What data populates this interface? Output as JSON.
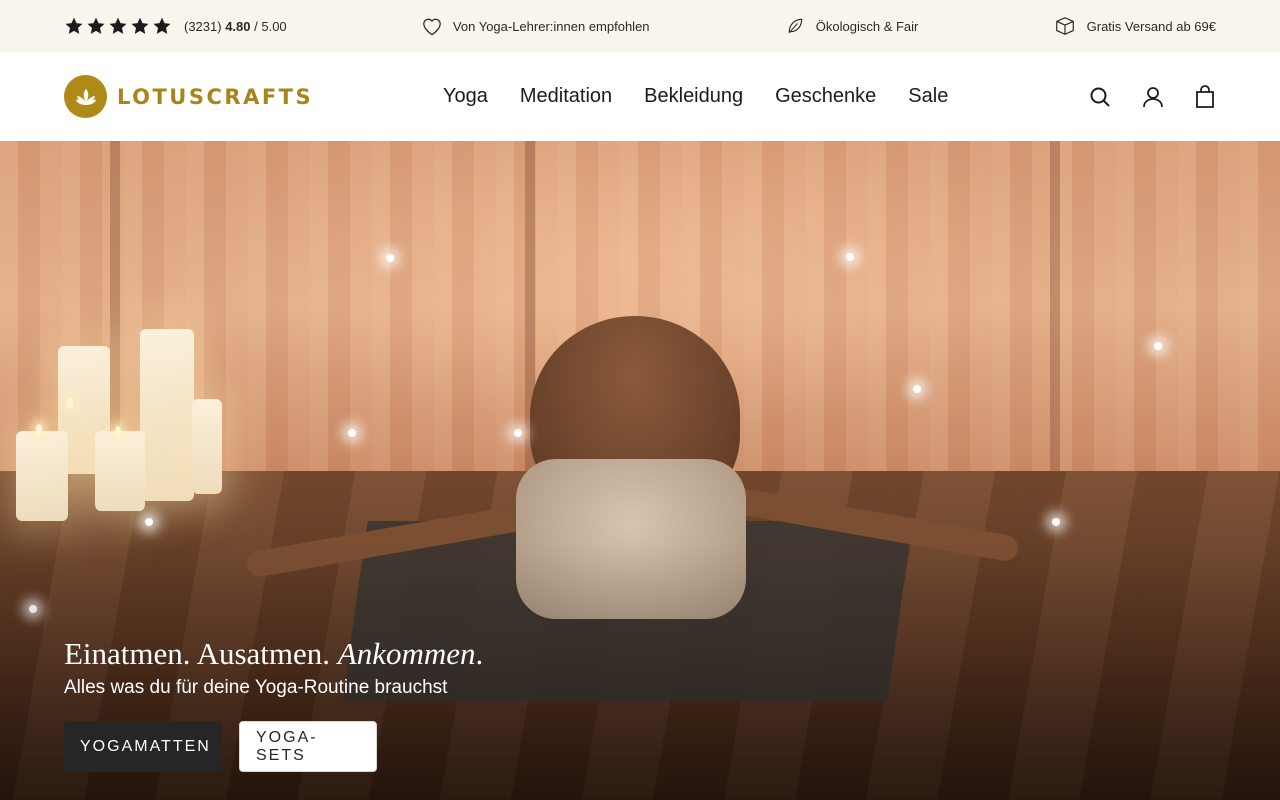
{
  "topbar": {
    "rating_count": "(3231)",
    "rating_value": "4.80",
    "rating_max": "/ 5.00",
    "stars": 5,
    "recommended": "Von Yoga-Lehrer:innen empfohlen",
    "eco": "Ökologisch & Fair",
    "shipping": "Gratis Versand ab 69€",
    "icons": [
      "star-icon",
      "heart-icon",
      "leaf-icon",
      "package-icon"
    ]
  },
  "header": {
    "logo_text": "LOTUSCRAFTS",
    "nav": [
      "Yoga",
      "Meditation",
      "Bekleidung",
      "Geschenke",
      "Sale"
    ],
    "icons": [
      "search-icon",
      "account-icon",
      "bag-icon"
    ]
  },
  "hero": {
    "title_main": "Einatmen. Ausatmen. ",
    "title_emph": "Ankommen",
    "title_end": ".",
    "subtitle": "Alles was du für deine Yoga-Routine brauchst",
    "buttons": [
      "YOGAMATTEN",
      "YOGA-SETS"
    ]
  },
  "colors": {
    "brand": "#a8841a",
    "topbar_bg": "#f7f5ec",
    "button_dark": "#262626"
  }
}
